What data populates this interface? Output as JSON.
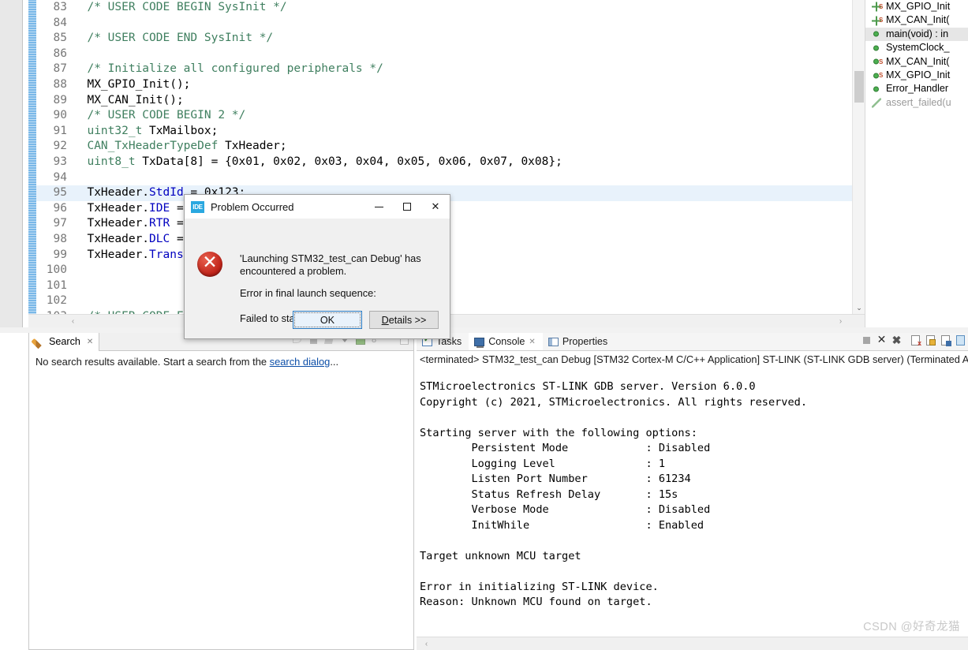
{
  "editor": {
    "lines": [
      {
        "num": "83",
        "segments": [
          {
            "t": "  /* USER CODE BEGIN SysInit */",
            "c": "cmt"
          }
        ]
      },
      {
        "num": "84",
        "segments": [
          {
            "t": "",
            "c": "txt"
          }
        ]
      },
      {
        "num": "85",
        "segments": [
          {
            "t": "  /* USER CODE END SysInit */",
            "c": "cmt"
          }
        ]
      },
      {
        "num": "86",
        "segments": [
          {
            "t": "",
            "c": "txt"
          }
        ]
      },
      {
        "num": "87",
        "segments": [
          {
            "t": "  /* Initialize all configured peripherals */",
            "c": "cmt"
          }
        ]
      },
      {
        "num": "88",
        "segments": [
          {
            "t": "  MX_GPIO_Init();",
            "c": "txt"
          }
        ]
      },
      {
        "num": "89",
        "segments": [
          {
            "t": "  MX_CAN_Init();",
            "c": "txt"
          }
        ]
      },
      {
        "num": "90",
        "segments": [
          {
            "t": "  /* USER CODE BEGIN 2 */",
            "c": "cmt"
          }
        ]
      },
      {
        "num": "91",
        "segments": [
          {
            "t": "  ",
            "c": "txt"
          },
          {
            "t": "uint32_t",
            "c": "typ"
          },
          {
            "t": " TxMailbox;",
            "c": "txt"
          }
        ]
      },
      {
        "num": "92",
        "segments": [
          {
            "t": "  ",
            "c": "txt"
          },
          {
            "t": "CAN_TxHeaderTypeDef",
            "c": "typ"
          },
          {
            "t": " TxHeader;",
            "c": "txt"
          }
        ]
      },
      {
        "num": "93",
        "segments": [
          {
            "t": "  ",
            "c": "txt"
          },
          {
            "t": "uint8_t",
            "c": "typ"
          },
          {
            "t": " TxData[8] = {0x01, 0x02, 0x03, 0x04, 0x05, 0x06, 0x07, 0x08};",
            "c": "txt"
          }
        ]
      },
      {
        "num": "94",
        "segments": [
          {
            "t": "",
            "c": "txt"
          }
        ]
      },
      {
        "num": "95",
        "highlight": true,
        "segments": [
          {
            "t": "  TxHeader.",
            "c": "txt"
          },
          {
            "t": "StdId",
            "c": "fld"
          },
          {
            "t": " = 0x123;",
            "c": "txt"
          }
        ]
      },
      {
        "num": "96",
        "segments": [
          {
            "t": "  TxHeader.",
            "c": "txt"
          },
          {
            "t": "IDE",
            "c": "fld"
          },
          {
            "t": " =",
            "c": "txt"
          }
        ]
      },
      {
        "num": "97",
        "segments": [
          {
            "t": "  TxHeader.",
            "c": "txt"
          },
          {
            "t": "RTR",
            "c": "fld"
          },
          {
            "t": " =",
            "c": "txt"
          }
        ]
      },
      {
        "num": "98",
        "segments": [
          {
            "t": "  TxHeader.",
            "c": "txt"
          },
          {
            "t": "DLC",
            "c": "fld"
          },
          {
            "t": " =",
            "c": "txt"
          }
        ]
      },
      {
        "num": "99",
        "segments": [
          {
            "t": "  TxHeader.",
            "c": "txt"
          },
          {
            "t": "Transm",
            "c": "fld"
          }
        ]
      },
      {
        "num": "100",
        "segments": [
          {
            "t": "",
            "c": "txt"
          }
        ]
      },
      {
        "num": "101",
        "segments": [
          {
            "t": "",
            "c": "txt"
          }
        ]
      },
      {
        "num": "102",
        "segments": [
          {
            "t": "",
            "c": "txt"
          }
        ]
      },
      {
        "num": "103",
        "segments": [
          {
            "t": "  /* USER CODE EN",
            "c": "cmt"
          }
        ]
      }
    ]
  },
  "outline": {
    "items": [
      {
        "label": "MX_GPIO_Init",
        "icon": "prototype-icon",
        "static": true,
        "selected": false,
        "dim": false
      },
      {
        "label": "MX_CAN_Init(",
        "icon": "prototype-icon",
        "static": true,
        "selected": false,
        "dim": false
      },
      {
        "label": "main(void) : in",
        "icon": "method-green-icon",
        "static": false,
        "selected": true,
        "dim": false
      },
      {
        "label": "SystemClock_",
        "icon": "method-green-icon",
        "static": false,
        "selected": false,
        "dim": false
      },
      {
        "label": "MX_CAN_Init(",
        "icon": "method-green-icon",
        "static": true,
        "selected": false,
        "dim": false
      },
      {
        "label": "MX_GPIO_Init",
        "icon": "method-green-icon",
        "static": true,
        "selected": false,
        "dim": false
      },
      {
        "label": "Error_Handler",
        "icon": "method-green-icon",
        "static": false,
        "selected": false,
        "dim": false
      },
      {
        "label": "assert_failed(u",
        "icon": "wand-icon",
        "static": false,
        "selected": false,
        "dim": true
      }
    ]
  },
  "search_view": {
    "tab_label": "Search",
    "tab_close": "✕",
    "message_prefix": "No search results available. Start a search from the ",
    "message_link": "search dialog",
    "message_suffix": "..."
  },
  "console_view": {
    "tabs": [
      {
        "label": "Tasks",
        "icon": "tasks-icon",
        "active": false,
        "closable": false
      },
      {
        "label": "Console",
        "icon": "console-icon",
        "active": true,
        "closable": true
      },
      {
        "label": "Properties",
        "icon": "properties-icon",
        "active": false,
        "closable": false
      }
    ],
    "close_glyph": "✕",
    "header": "<terminated> STM32_test_can Debug [STM32 Cortex-M C/C++ Application] ST-LINK (ST-LINK GDB server) (Terminated A",
    "output": "STMicroelectronics ST-LINK GDB server. Version 6.0.0\nCopyright (c) 2021, STMicroelectronics. All rights reserved.\n\nStarting server with the following options:\n        Persistent Mode            : Disabled\n        Logging Level              : 1\n        Listen Port Number         : 61234\n        Status Refresh Delay       : 15s\n        Verbose Mode               : Disabled\n        InitWhile                  : Enabled\n\nTarget unknown MCU target\n\nError in initializing ST-LINK device.\nReason: Unknown MCU found on target."
  },
  "dialog": {
    "app_icon_text": "IDE",
    "title": "Problem Occurred",
    "minimize": "—",
    "maximize": "□",
    "close": "✕",
    "message_line1": "'Launching STM32_test_can Debug' has",
    "message_line2": "encountered a problem.",
    "message_line3": "Error in final launch sequence:",
    "message_line4": "Failed to start GDB server",
    "ok_label": "OK",
    "details_label_underlined": "D",
    "details_label_rest": "etails >>"
  },
  "watermark": {
    "text": "CSDN @好奇龙猫"
  },
  "colors": {
    "comment_green": "#3f7f5f",
    "type_green": "#3f7f5f",
    "field_blue": "#0000c0",
    "highlight_line": "#e8f2fb",
    "marker_bar": "#7ab8e8",
    "error_red": "#c0241a",
    "link_blue": "#0d4fa8",
    "dialog_bg": "#f0f0f0",
    "outline_selected": "#e6e6e6"
  }
}
